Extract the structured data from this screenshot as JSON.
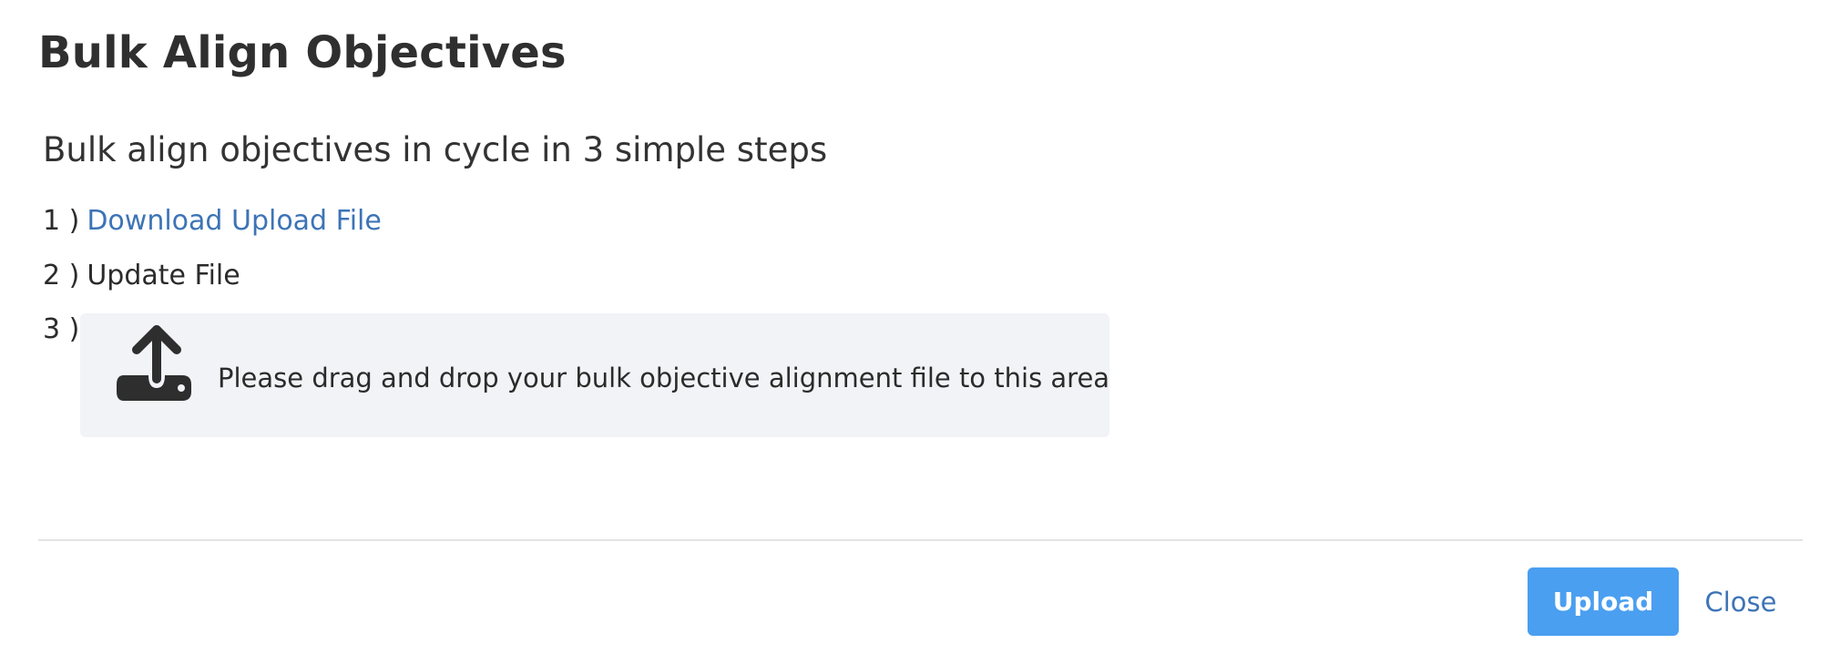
{
  "modal": {
    "title": "Bulk Align Objectives",
    "intro": "Bulk align objectives in cycle in 3 simple steps"
  },
  "steps": [
    {
      "number": "1 )",
      "text": "Download Upload File",
      "is_link": true
    },
    {
      "number": "2 )",
      "text": "Update File",
      "is_link": false
    },
    {
      "number": "3 )"
    }
  ],
  "dropzone": {
    "icon": "upload-icon",
    "text": "Please drag and drop your bulk objective alignment file to this area"
  },
  "footer": {
    "upload_label": "Upload",
    "close_label": "Close"
  },
  "colors": {
    "primary": "#4a9ff0",
    "link": "#3d74b6",
    "dropzone_bg": "#f2f3f7",
    "text": "#2b2b2b"
  }
}
